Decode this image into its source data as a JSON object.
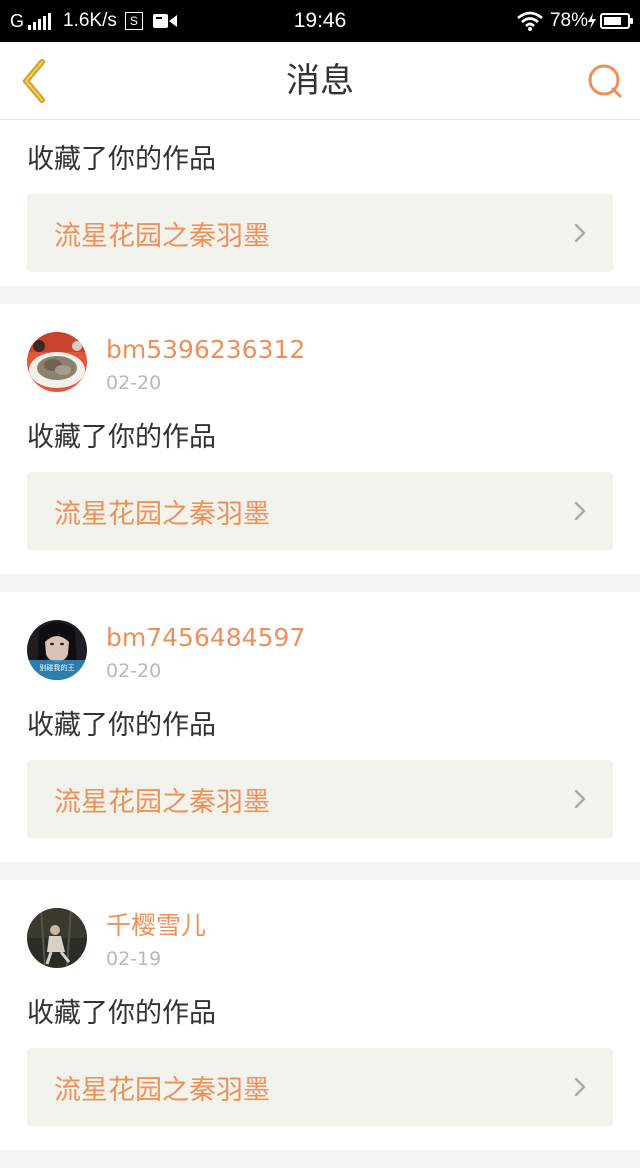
{
  "status_bar": {
    "carrier": "G",
    "speed": "1.6K/s",
    "s_badge": "S",
    "time": "19:46",
    "battery": "78%",
    "battery_level": 0.78
  },
  "header": {
    "title": "消息",
    "back_icon": "chevron-left-icon",
    "search_icon": "search-icon"
  },
  "colors": {
    "accent": "#ee9059",
    "back_accent": "#d4a02a",
    "link_bg": "#f3f3ee"
  },
  "messages": [
    {
      "action": "收藏了你的作品",
      "work_title": "流星花园之秦羽墨"
    },
    {
      "username": "bm5396236312",
      "date": "02-20",
      "action": "收藏了你的作品",
      "work_title": "流星花园之秦羽墨"
    },
    {
      "username": "bm7456484597",
      "date": "02-20",
      "action": "收藏了你的作品",
      "work_title": "流星花园之秦羽墨",
      "avatar_caption": "别碰我的王"
    },
    {
      "username": "千樱雪儿",
      "date": "02-19",
      "action": "收藏了你的作品",
      "work_title": "流星花园之秦羽墨"
    }
  ]
}
